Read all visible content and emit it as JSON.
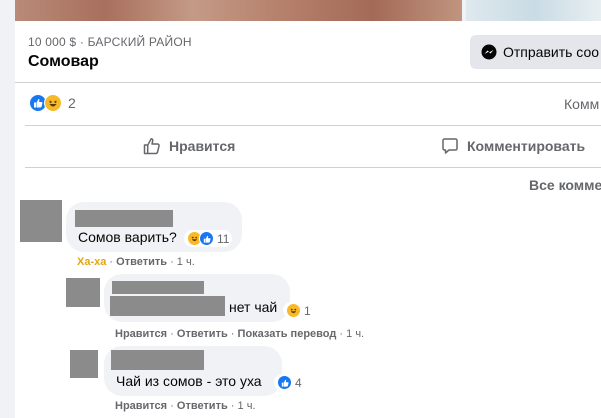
{
  "listing": {
    "price_location": "10 000 $ · БАРСКИЙ РАЙОН",
    "title": "Сомовар",
    "send_label": "Отправить соо"
  },
  "stats": {
    "reaction_count": "2",
    "comments_label": "Комм"
  },
  "actions": {
    "like_label": "Нравится",
    "comment_label": "Комментировать"
  },
  "sort_label": "Все комме",
  "comments": [
    {
      "text": "Сомов варить?",
      "reaction_count": "11",
      "reacted_label": "Ха-ха",
      "reply_label": "Ответить",
      "time": "1 ч."
    },
    {
      "text": "нет чай",
      "reaction_count": "1",
      "like_label": "Нравится",
      "reply_label": "Ответить",
      "translate_label": "Показать перевод",
      "time": "1 ч."
    },
    {
      "text": "Чай из сомов - это уха",
      "reaction_count": "4",
      "like_label": "Нравится",
      "reply_label": "Ответить",
      "time": "1 ч."
    }
  ],
  "colors": {
    "accent": "#1877f2",
    "haha": "#f7b928",
    "secondary_text": "#65676b",
    "redaction": "#8b8b8b"
  },
  "icons": [
    "messenger-icon",
    "like-reaction-icon",
    "haha-reaction-icon",
    "thumbs-up-icon",
    "comment-icon"
  ]
}
